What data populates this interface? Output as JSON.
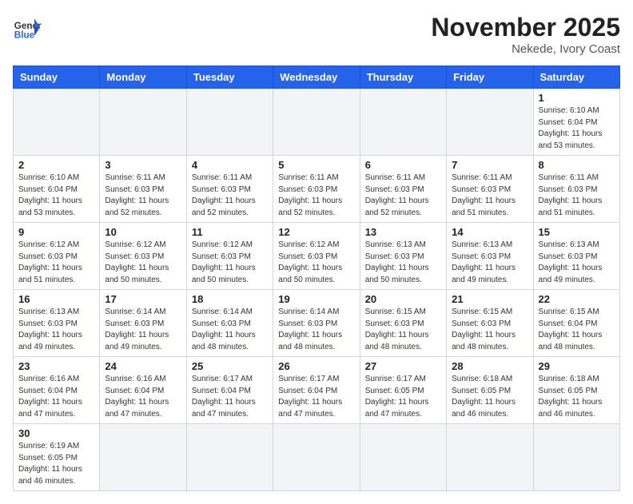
{
  "header": {
    "logo_general": "General",
    "logo_blue": "Blue",
    "month_title": "November 2025",
    "location": "Nekede, Ivory Coast"
  },
  "weekdays": [
    "Sunday",
    "Monday",
    "Tuesday",
    "Wednesday",
    "Thursday",
    "Friday",
    "Saturday"
  ],
  "weeks": [
    [
      {
        "day": "",
        "info": ""
      },
      {
        "day": "",
        "info": ""
      },
      {
        "day": "",
        "info": ""
      },
      {
        "day": "",
        "info": ""
      },
      {
        "day": "",
        "info": ""
      },
      {
        "day": "",
        "info": ""
      },
      {
        "day": "1",
        "info": "Sunrise: 6:10 AM\nSunset: 6:04 PM\nDaylight: 11 hours\nand 53 minutes."
      }
    ],
    [
      {
        "day": "2",
        "info": "Sunrise: 6:10 AM\nSunset: 6:04 PM\nDaylight: 11 hours\nand 53 minutes."
      },
      {
        "day": "3",
        "info": "Sunrise: 6:11 AM\nSunset: 6:03 PM\nDaylight: 11 hours\nand 52 minutes."
      },
      {
        "day": "4",
        "info": "Sunrise: 6:11 AM\nSunset: 6:03 PM\nDaylight: 11 hours\nand 52 minutes."
      },
      {
        "day": "5",
        "info": "Sunrise: 6:11 AM\nSunset: 6:03 PM\nDaylight: 11 hours\nand 52 minutes."
      },
      {
        "day": "6",
        "info": "Sunrise: 6:11 AM\nSunset: 6:03 PM\nDaylight: 11 hours\nand 52 minutes."
      },
      {
        "day": "7",
        "info": "Sunrise: 6:11 AM\nSunset: 6:03 PM\nDaylight: 11 hours\nand 51 minutes."
      },
      {
        "day": "8",
        "info": "Sunrise: 6:11 AM\nSunset: 6:03 PM\nDaylight: 11 hours\nand 51 minutes."
      }
    ],
    [
      {
        "day": "9",
        "info": "Sunrise: 6:12 AM\nSunset: 6:03 PM\nDaylight: 11 hours\nand 51 minutes."
      },
      {
        "day": "10",
        "info": "Sunrise: 6:12 AM\nSunset: 6:03 PM\nDaylight: 11 hours\nand 50 minutes."
      },
      {
        "day": "11",
        "info": "Sunrise: 6:12 AM\nSunset: 6:03 PM\nDaylight: 11 hours\nand 50 minutes."
      },
      {
        "day": "12",
        "info": "Sunrise: 6:12 AM\nSunset: 6:03 PM\nDaylight: 11 hours\nand 50 minutes."
      },
      {
        "day": "13",
        "info": "Sunrise: 6:13 AM\nSunset: 6:03 PM\nDaylight: 11 hours\nand 50 minutes."
      },
      {
        "day": "14",
        "info": "Sunrise: 6:13 AM\nSunset: 6:03 PM\nDaylight: 11 hours\nand 49 minutes."
      },
      {
        "day": "15",
        "info": "Sunrise: 6:13 AM\nSunset: 6:03 PM\nDaylight: 11 hours\nand 49 minutes."
      }
    ],
    [
      {
        "day": "16",
        "info": "Sunrise: 6:13 AM\nSunset: 6:03 PM\nDaylight: 11 hours\nand 49 minutes."
      },
      {
        "day": "17",
        "info": "Sunrise: 6:14 AM\nSunset: 6:03 PM\nDaylight: 11 hours\nand 49 minutes."
      },
      {
        "day": "18",
        "info": "Sunrise: 6:14 AM\nSunset: 6:03 PM\nDaylight: 11 hours\nand 48 minutes."
      },
      {
        "day": "19",
        "info": "Sunrise: 6:14 AM\nSunset: 6:03 PM\nDaylight: 11 hours\nand 48 minutes."
      },
      {
        "day": "20",
        "info": "Sunrise: 6:15 AM\nSunset: 6:03 PM\nDaylight: 11 hours\nand 48 minutes."
      },
      {
        "day": "21",
        "info": "Sunrise: 6:15 AM\nSunset: 6:03 PM\nDaylight: 11 hours\nand 48 minutes."
      },
      {
        "day": "22",
        "info": "Sunrise: 6:15 AM\nSunset: 6:04 PM\nDaylight: 11 hours\nand 48 minutes."
      }
    ],
    [
      {
        "day": "23",
        "info": "Sunrise: 6:16 AM\nSunset: 6:04 PM\nDaylight: 11 hours\nand 47 minutes."
      },
      {
        "day": "24",
        "info": "Sunrise: 6:16 AM\nSunset: 6:04 PM\nDaylight: 11 hours\nand 47 minutes."
      },
      {
        "day": "25",
        "info": "Sunrise: 6:17 AM\nSunset: 6:04 PM\nDaylight: 11 hours\nand 47 minutes."
      },
      {
        "day": "26",
        "info": "Sunrise: 6:17 AM\nSunset: 6:04 PM\nDaylight: 11 hours\nand 47 minutes."
      },
      {
        "day": "27",
        "info": "Sunrise: 6:17 AM\nSunset: 6:05 PM\nDaylight: 11 hours\nand 47 minutes."
      },
      {
        "day": "28",
        "info": "Sunrise: 6:18 AM\nSunset: 6:05 PM\nDaylight: 11 hours\nand 46 minutes."
      },
      {
        "day": "29",
        "info": "Sunrise: 6:18 AM\nSunset: 6:05 PM\nDaylight: 11 hours\nand 46 minutes."
      }
    ],
    [
      {
        "day": "30",
        "info": "Sunrise: 6:19 AM\nSunset: 6:05 PM\nDaylight: 11 hours\nand 46 minutes."
      },
      {
        "day": "",
        "info": ""
      },
      {
        "day": "",
        "info": ""
      },
      {
        "day": "",
        "info": ""
      },
      {
        "day": "",
        "info": ""
      },
      {
        "day": "",
        "info": ""
      },
      {
        "day": "",
        "info": ""
      }
    ]
  ]
}
